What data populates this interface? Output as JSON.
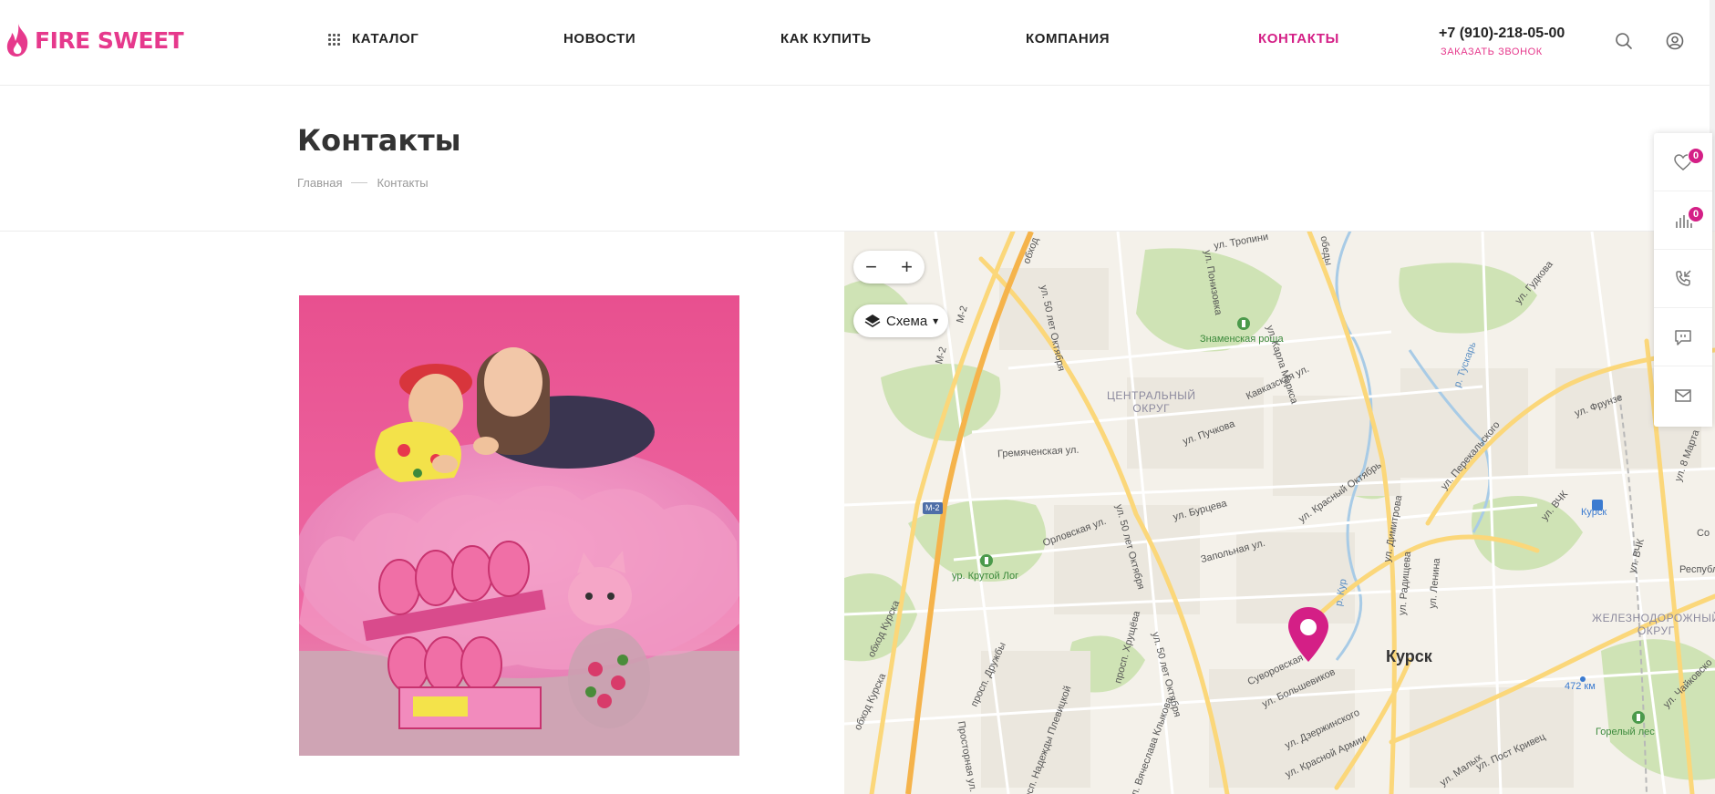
{
  "header": {
    "logo_text": "FIRE SWEET",
    "nav": {
      "catalog": "КАТАЛОГ",
      "news": "НОВОСТИ",
      "how_to_buy": "КАК КУПИТЬ",
      "company": "КОМПАНИЯ",
      "contacts": "КОНТАКТЫ"
    },
    "phone": "+7 (910)-218-05-00",
    "callback": "ЗАКАЗАТЬ ЗВОНОК",
    "icons": [
      "search-icon",
      "user-icon"
    ]
  },
  "page": {
    "title": "Контакты",
    "breadcrumb": {
      "home": "Главная",
      "current": "Контакты"
    }
  },
  "map": {
    "zoom_out": "−",
    "zoom_in": "+",
    "layer_label": "Схема",
    "layer_arrow": "▾",
    "labels": {
      "city": "Курск",
      "district_central_1": "ЦЕНТРАЛЬНЫЙ",
      "district_central_2": "ОКРУГ",
      "district_rail_1": "ЖЕЛЕЗНОДОРОЖНЫЙ",
      "district_rail_2": "ОКРУГ",
      "park_znamenskaya": "Знаменская роща",
      "park_krutoy_log": "ур. Крутой Лог",
      "park_gorely_les": "Горелый лес",
      "kursk_station": "Курск",
      "km_472": "472 км",
      "m2_a": "М-2",
      "m2_b": "М-2",
      "m2_badge": "М-2",
      "st_50let_1": "ул. 50 лет Октября",
      "st_50let_2": "ул. 50 лет Октября",
      "st_50let_3": "ул. 50 лет Октября",
      "st_karla_marksa": "ул. Карла Маркса",
      "st_kavkazskaya": "Кавказская ул.",
      "st_puchkova": "ул. Пучкова",
      "st_gremyachenskaya": "Гремяченская ул.",
      "st_burtseva": "ул. Бурцева",
      "st_orlovskaya": "Орловская ул.",
      "st_zapolnaya": "Запольная ул.",
      "st_krasny_oktyabr": "ул. Красный Октябрь",
      "st_dimitrova": "ул. Димитрова",
      "st_radishcheva": "ул. Радищева",
      "st_lenina": "ул. Ленина",
      "st_bolshevikov": "ул. Большевиков",
      "st_suvorovskaya": "Суворовская",
      "st_dzerzhinskogo": "ул. Дзержинского",
      "st_krasnoy_armii": "ул. Красной Армии",
      "st_obhod_kurska_1": "обход Курска",
      "st_obhod_kurska_2": "обход Курска",
      "st_obhod_top": "обход",
      "st_druzhby": "просп. Дружбы",
      "st_khrushcheva": "просп. Хрущёва",
      "st_plevitskoy": "просп. Надежды Плевицкой",
      "st_klykova": "просп. Вячеслава Клыкова",
      "st_prostornaya": "Просторная ул.",
      "st_pobedy": "обеды",
      "st_tropinina": "ул. Тропини",
      "st_ponizovka": "ул. Понизовка",
      "st_gudkova": "ул. Гудкова",
      "st_frunze": "ул. Фрунзе",
      "st_perekalskogo": "ул. Перекальского",
      "st_8marta": "ул. 8 Марта",
      "st_vchk_1": "ул. ВЧК",
      "st_vchk_2": "ул. ВЧК",
      "st_respubl": "Республ",
      "st_chaykovskogo": "ул. Чайковско",
      "st_post_krivets": "ул. Пост Кривец",
      "st_malykh": "ул. Малых",
      "st_tuskar": "р. Тускарь",
      "st_kur": "р. Кур",
      "st_so": "Со"
    }
  },
  "side_panel": {
    "favorites_count": "0",
    "compare_count": "0",
    "icons": [
      "heart-icon",
      "compare-icon",
      "callback-phone-icon",
      "chat-icon",
      "mail-icon"
    ]
  },
  "colors": {
    "brand": "#e6398c",
    "accent": "#d41f86"
  }
}
